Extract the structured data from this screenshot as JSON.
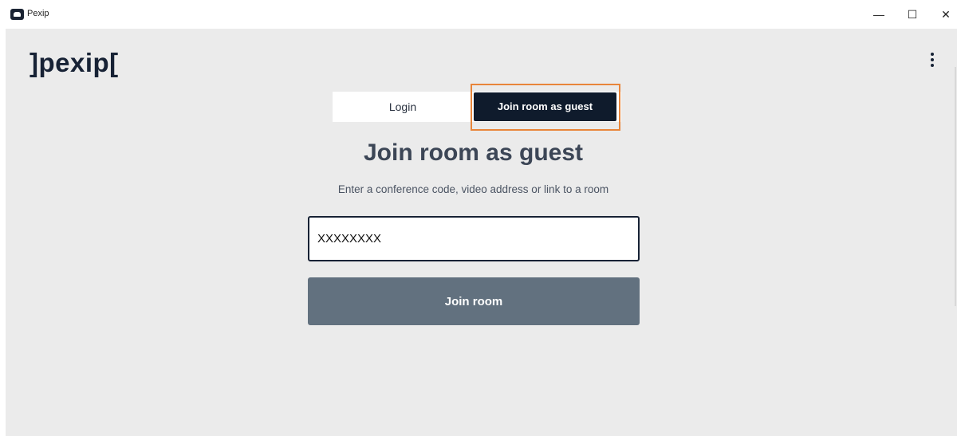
{
  "window": {
    "title": "Pexip",
    "minimize_glyph": "—",
    "maximize_glyph": "☐",
    "close_glyph": "✕"
  },
  "app": {
    "logo": "]pexip[",
    "menu_icon": "more-vertical-icon"
  },
  "tabs": [
    {
      "label": "Login",
      "active": false
    },
    {
      "label": "Join room as guest",
      "active": true
    }
  ],
  "join": {
    "heading": "Join room as guest",
    "subtitle": "Enter a conference code, video address or link to a room",
    "input_value": "XXXXXXXX",
    "button_label": "Join room"
  },
  "colors": {
    "brand_dark": "#0f1b2c",
    "background": "#ebebeb",
    "button": "#62717f",
    "highlight": "#e8853a"
  }
}
